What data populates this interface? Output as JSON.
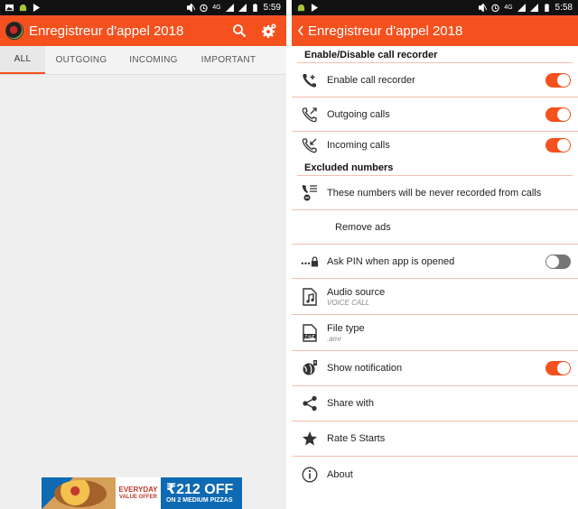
{
  "left": {
    "status": {
      "time": "5:59",
      "network": "4G"
    },
    "app_title": "Enregistreur d'appel 2018",
    "tabs": [
      "ALL",
      "OUTGOING",
      "INCOMING",
      "IMPORTANT"
    ],
    "active_tab": "ALL",
    "ad": {
      "line1": "EVERYDAY",
      "line2": "VALUE OFFER",
      "price": "₹212 OFF",
      "detail": "ON 2 MEDIUM PIZZAS"
    }
  },
  "right": {
    "status": {
      "time": "5:58",
      "network": "4G"
    },
    "app_title": "Enregistreur d'appel 2018",
    "sections": {
      "recorder": "Enable/Disable call recorder",
      "excluded": "Excluded numbers"
    },
    "settings": {
      "enable_recorder": {
        "label": "Enable call recorder",
        "on": true
      },
      "outgoing": {
        "label": "Outgoing calls",
        "on": true
      },
      "incoming": {
        "label": "Incoming calls",
        "on": true
      },
      "excluded_desc": {
        "label": "These numbers will be never recorded from calls"
      },
      "remove_ads": {
        "label": "Remove ads"
      },
      "ask_pin": {
        "label": "Ask PIN when app is opened",
        "on": false
      },
      "audio_source": {
        "label": "Audio source",
        "value": "VOICE CALL"
      },
      "file_type": {
        "label": "File type",
        "value": ".amr"
      },
      "show_notification": {
        "label": "Show notification",
        "on": true
      },
      "share": {
        "label": "Share with"
      },
      "rate": {
        "label": "Rate 5 Starts"
      },
      "about": {
        "label": "About"
      }
    }
  },
  "colors": {
    "accent": "#f4511e",
    "divider": "#f4bfae",
    "status_bar": "#111111"
  }
}
